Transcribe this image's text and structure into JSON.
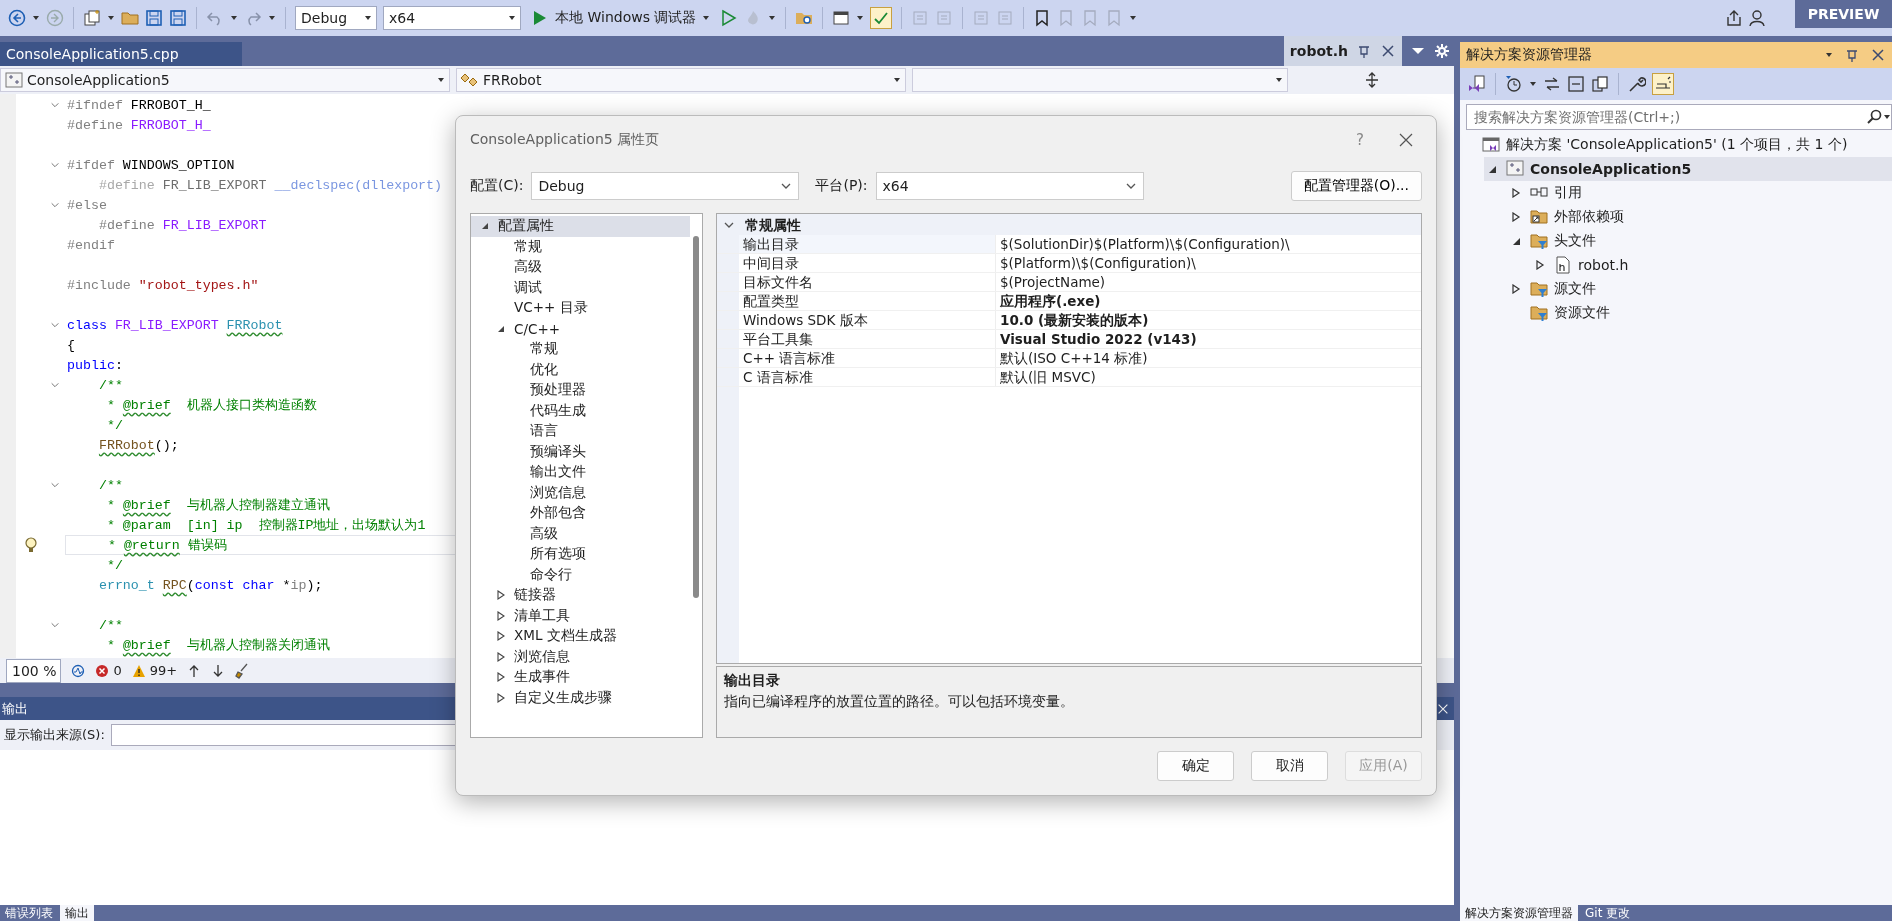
{
  "toolbar": {
    "config": "Debug",
    "platform": "x64",
    "run_label": "本地 Windows 调试器",
    "preview": "PREVIEW"
  },
  "doc_tabs": [
    {
      "label": "ConsoleApplication5.cpp",
      "selected": false
    },
    {
      "label": "robot.h",
      "selected": true
    }
  ],
  "navbar": {
    "project": "ConsoleApplication5",
    "scope": "FRRobot"
  },
  "editor": {
    "lines": [
      {
        "fold": true,
        "tokens": [
          {
            "kind": "pp",
            "text": "#ifndef "
          },
          {
            "kind": "plain",
            "text": "FRROBOT_H_"
          }
        ]
      },
      {
        "fold": false,
        "tokens": [
          {
            "kind": "pp",
            "text": "#define "
          },
          {
            "kind": "macro",
            "text": "FRROBOT_H_"
          }
        ]
      },
      {
        "fold": false
      },
      {
        "fold": true,
        "tokens": [
          {
            "kind": "pp",
            "text": "#ifdef "
          },
          {
            "kind": "plain",
            "text": "WINDOWS_OPTION"
          }
        ]
      },
      {
        "fold": false,
        "tokens": [
          {
            "kind": "inactive",
            "text": "    #define "
          },
          {
            "kind": "inactive_name",
            "text": "FR_LIB_EXPORT "
          },
          {
            "kind": "inactive_keyword",
            "text": "__declspec(dllexport)"
          }
        ]
      },
      {
        "fold": true,
        "tokens": [
          {
            "kind": "pp",
            "text": "#else"
          }
        ]
      },
      {
        "fold": false,
        "tokens": [
          {
            "kind": "pp",
            "text": "    #define "
          },
          {
            "kind": "macro",
            "text": "FR_LIB_EXPORT"
          }
        ]
      },
      {
        "fold": false,
        "tokens": [
          {
            "kind": "pp",
            "text": "#endif"
          }
        ]
      },
      {
        "fold": false
      },
      {
        "fold": false,
        "tokens": [
          {
            "kind": "pp",
            "text": "#include "
          },
          {
            "kind": "string",
            "text": "\"robot_types.h\""
          }
        ]
      },
      {
        "fold": false
      },
      {
        "fold": true,
        "tokens": [
          {
            "kind": "keyword",
            "text": "class "
          },
          {
            "kind": "macro",
            "text": "FR_LIB_EXPORT "
          },
          {
            "kind": "type",
            "text": "FRRobot",
            "squiggle": true
          }
        ]
      },
      {
        "fold": false,
        "tokens": [
          {
            "kind": "plain",
            "text": "{"
          }
        ]
      },
      {
        "fold": false,
        "tokens": [
          {
            "kind": "keyword",
            "text": "public"
          },
          {
            "kind": "plain",
            "text": ":"
          }
        ]
      },
      {
        "fold": true,
        "tokens": [
          {
            "kind": "comment",
            "text": "    /**"
          }
        ]
      },
      {
        "fold": false,
        "tokens": [
          {
            "kind": "comment",
            "text": "     * "
          },
          {
            "kind": "comment",
            "text": "@brief",
            "squiggle": true
          },
          {
            "kind": "comment",
            "text": "  机器人接口类构造函数"
          }
        ]
      },
      {
        "fold": false,
        "tokens": [
          {
            "kind": "comment",
            "text": "     */"
          }
        ]
      },
      {
        "fold": false,
        "tokens": [
          {
            "kind": "function",
            "text": "    FRRobot",
            "squiggle": true
          },
          {
            "kind": "plain",
            "text": "();"
          }
        ]
      },
      {
        "fold": false
      },
      {
        "fold": true,
        "tokens": [
          {
            "kind": "comment",
            "text": "    /**"
          }
        ]
      },
      {
        "fold": false,
        "tokens": [
          {
            "kind": "comment",
            "text": "     * "
          },
          {
            "kind": "comment",
            "text": "@brief",
            "squiggle": true
          },
          {
            "kind": "comment",
            "text": "  与机器人控制器建立通讯"
          }
        ]
      },
      {
        "fold": false,
        "tokens": [
          {
            "kind": "comment",
            "text": "     * @param  [in] ip  控制器IP地址，出场默认为1"
          }
        ]
      },
      {
        "fold": false,
        "current": true,
        "lightbulb": true,
        "tokens": [
          {
            "kind": "comment",
            "text": "     * "
          },
          {
            "kind": "comment",
            "text": "@return",
            "squiggle": true
          },
          {
            "kind": "comment",
            "text": " 错误码"
          }
        ]
      },
      {
        "fold": false,
        "tokens": [
          {
            "kind": "comment",
            "text": "     */"
          }
        ]
      },
      {
        "fold": false,
        "tokens": [
          {
            "kind": "type",
            "text": "    errno_t "
          },
          {
            "kind": "function",
            "text": "RPC",
            "squiggle": true
          },
          {
            "kind": "plain",
            "text": "("
          },
          {
            "kind": "keyword",
            "text": "const char "
          },
          {
            "kind": "plain",
            "text": "*"
          },
          {
            "kind": "parameter",
            "text": "ip"
          },
          {
            "kind": "plain",
            "text": ");"
          }
        ]
      },
      {
        "fold": false
      },
      {
        "fold": true,
        "tokens": [
          {
            "kind": "comment",
            "text": "    /**"
          }
        ]
      },
      {
        "fold": false,
        "tokens": [
          {
            "kind": "comment",
            "text": "     * "
          },
          {
            "kind": "comment",
            "text": "@brief",
            "squiggle": true
          },
          {
            "kind": "comment",
            "text": "  与机器人控制器关闭通讯"
          }
        ]
      }
    ]
  },
  "status_bar": {
    "zoom": "100 %",
    "errors": "0",
    "warnings": "99+"
  },
  "output": {
    "title": "输出",
    "source_label": "显示输出来源(S):"
  },
  "bottom_tabs": [
    {
      "label": "错误列表",
      "selected": false
    },
    {
      "label": "输出",
      "selected": true
    }
  ],
  "solution_explorer": {
    "title": "解决方案资源管理器",
    "search_placeholder": "搜索解决方案资源管理器(Ctrl+;)",
    "tree": [
      {
        "label": "解决方案 'ConsoleApplication5' (1 个项目，共 1 个)",
        "kind": "solution",
        "selected": false,
        "children": [
          {
            "label": "ConsoleApplication5",
            "kind": "project",
            "expanded": true,
            "selected": true,
            "children": [
              {
                "label": "引用",
                "kind": "references",
                "expanded": false,
                "selected": false
              },
              {
                "label": "外部依赖项",
                "kind": "external",
                "expanded": false,
                "selected": false
              },
              {
                "label": "头文件",
                "kind": "filter",
                "expanded": true,
                "selected": false,
                "children": [
                  {
                    "label": "robot.h",
                    "kind": "header",
                    "expanded": false,
                    "selected": false
                  }
                ]
              },
              {
                "label": "源文件",
                "kind": "filter",
                "expanded": false,
                "selected": false
              },
              {
                "label": "资源文件",
                "kind": "filter",
                "selected": false
              }
            ]
          }
        ]
      }
    ],
    "bottom_tabs": [
      {
        "label": "解决方案资源管理器",
        "selected": true
      },
      {
        "label": "Git 更改",
        "selected": false
      }
    ]
  },
  "dialog": {
    "title": "ConsoleApplication5 属性页",
    "help": "?",
    "config_label": "配置(C):",
    "config_value": "Debug",
    "platform_label": "平台(P):",
    "platform_value": "x64",
    "manager_button": "配置管理器(O)...",
    "tree": [
      {
        "label": "配置属性",
        "expanded": true,
        "selected": true,
        "children": [
          {
            "label": "常规",
            "selected": false
          },
          {
            "label": "高级",
            "selected": false
          },
          {
            "label": "调试",
            "selected": false
          },
          {
            "label": "VC++ 目录",
            "selected": false
          },
          {
            "label": "C/C++",
            "expanded": true,
            "selected": false,
            "children": [
              {
                "label": "常规",
                "selected": false
              },
              {
                "label": "优化",
                "selected": false
              },
              {
                "label": "预处理器",
                "selected": false
              },
              {
                "label": "代码生成",
                "selected": false
              },
              {
                "label": "语言",
                "selected": false
              },
              {
                "label": "预编译头",
                "selected": false
              },
              {
                "label": "输出文件",
                "selected": false
              },
              {
                "label": "浏览信息",
                "selected": false
              },
              {
                "label": "外部包含",
                "selected": false
              },
              {
                "label": "高级",
                "selected": false
              },
              {
                "label": "所有选项",
                "selected": false
              },
              {
                "label": "命令行",
                "selected": false
              }
            ]
          },
          {
            "label": "链接器",
            "expanded": false,
            "selected": false
          },
          {
            "label": "清单工具",
            "expanded": false,
            "selected": false
          },
          {
            "label": "XML 文档生成器",
            "expanded": false,
            "selected": false
          },
          {
            "label": "浏览信息",
            "expanded": false,
            "selected": false
          },
          {
            "label": "生成事件",
            "expanded": false,
            "selected": false
          },
          {
            "label": "自定义生成步骤",
            "expanded": false,
            "selected": false
          }
        ]
      }
    ],
    "grid": {
      "category": "常规属性",
      "expanded": true,
      "rows": [
        {
          "name": "输出目录",
          "value": "$(SolutionDir)$(Platform)\\$(Configuration)\\",
          "bold": false,
          "selected": true
        },
        {
          "name": "中间目录",
          "value": "$(Platform)\\$(Configuration)\\",
          "bold": false,
          "selected": false
        },
        {
          "name": "目标文件名",
          "value": "$(ProjectName)",
          "bold": false,
          "selected": false
        },
        {
          "name": "配置类型",
          "value": "应用程序(.exe)",
          "bold": true,
          "selected": false
        },
        {
          "name": "Windows SDK 版本",
          "value": "10.0 (最新安装的版本)",
          "bold": true,
          "selected": false
        },
        {
          "name": "平台工具集",
          "value": "Visual Studio 2022 (v143)",
          "bold": true,
          "selected": false
        },
        {
          "name": "C++ 语言标准",
          "value": "默认(ISO C++14 标准)",
          "bold": false,
          "selected": false
        },
        {
          "name": "C 语言标准",
          "value": "默认(旧 MSVC)",
          "bold": false,
          "selected": false
        }
      ]
    },
    "description": {
      "title": "输出目录",
      "text": "指向已编译程序的放置位置的路径。可以包括环境变量。"
    },
    "buttons": [
      {
        "label": "确定",
        "disabled": false
      },
      {
        "label": "取消",
        "disabled": false
      },
      {
        "label": "应用(A)",
        "disabled": true
      }
    ]
  }
}
